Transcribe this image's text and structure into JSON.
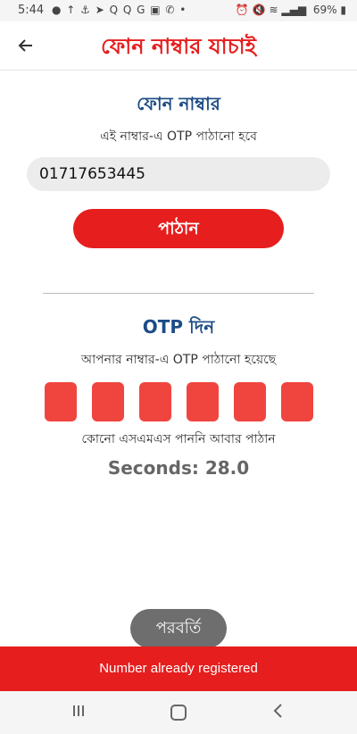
{
  "status_bar": {
    "time": "5:44",
    "notification_icons": "● ↑ ⚓ ➤ Q Q G ▣ ✆ •",
    "battery": "69%"
  },
  "app_bar": {
    "title": "ফোন নাম্বার যাচাই",
    "back_icon": "arrow-left"
  },
  "phone_section": {
    "title": "ফোন নাম্বার",
    "hint": "এই নাম্বার-এ OTP পাঠানো হবে",
    "phone_value": "01717653445",
    "send_label": "পাঠান"
  },
  "otp_section": {
    "title": "OTP দিন",
    "hint": "আপনার নাম্বার-এ OTP পাঠানো হয়েছে",
    "otp_digits": [
      "",
      "",
      "",
      "",
      "",
      ""
    ],
    "resend_prefix": "কোনো এসএমএস পাননি",
    "resend_link": "আবার পাঠান",
    "seconds_label": "Seconds: 28.0"
  },
  "next_label": "পরবর্তি",
  "snackbar_message": "Number already registered",
  "nav_bar": {
    "recents_icon": "recents",
    "home_icon": "home",
    "back_icon": "back"
  },
  "colors": {
    "accent": "#e61e1e",
    "title_blue": "#1d4c86",
    "otp_box": "#f0453f",
    "next_button": "#6e6e6e"
  }
}
